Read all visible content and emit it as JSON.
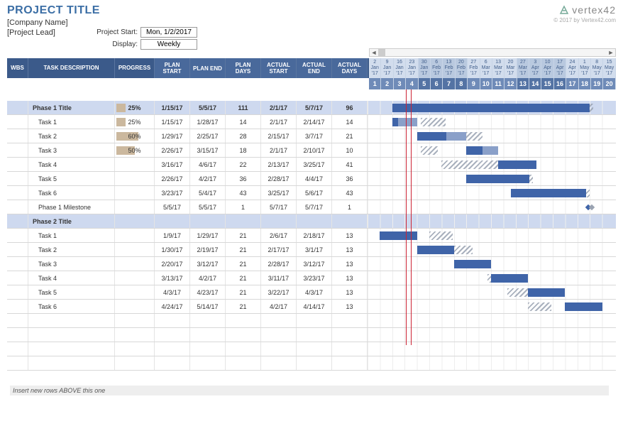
{
  "header": {
    "title": "PROJECT TITLE",
    "company": "[Company Name]",
    "lead": "[Project Lead]",
    "project_start_label": "Project Start:",
    "project_start_value": "Mon, 1/2/2017",
    "display_label": "Display:",
    "display_value": "Weekly",
    "logo_text": "vertex42",
    "copyright": "© 2017 by Vertex42.com"
  },
  "columns": {
    "wbs": "WBS",
    "task": "TASK DESCRIPTION",
    "progress": "PROGRESS",
    "plan_start": "PLAN START",
    "plan_end": "PLAN END",
    "plan_days": "PLAN DAYS",
    "actual_start": "ACTUAL START",
    "actual_end": "ACTUAL END",
    "actual_days": "ACTUAL DAYS"
  },
  "timeline": {
    "dates": [
      {
        "d": "2",
        "m": "Jan",
        "y": "'17"
      },
      {
        "d": "9",
        "m": "Jan",
        "y": "'17"
      },
      {
        "d": "16",
        "m": "Jan",
        "y": "'17"
      },
      {
        "d": "23",
        "m": "Jan",
        "y": "'17"
      },
      {
        "d": "30",
        "m": "Jan",
        "y": "'17"
      },
      {
        "d": "6",
        "m": "Feb",
        "y": "'17"
      },
      {
        "d": "13",
        "m": "Feb",
        "y": "'17"
      },
      {
        "d": "20",
        "m": "Feb",
        "y": "'17"
      },
      {
        "d": "27",
        "m": "Feb",
        "y": "'17"
      },
      {
        "d": "6",
        "m": "Mar",
        "y": "'17"
      },
      {
        "d": "13",
        "m": "Mar",
        "y": "'17"
      },
      {
        "d": "20",
        "m": "Mar",
        "y": "'17"
      },
      {
        "d": "27",
        "m": "Mar",
        "y": "'17"
      },
      {
        "d": "3",
        "m": "Apr",
        "y": "'17"
      },
      {
        "d": "10",
        "m": "Apr",
        "y": "'17"
      },
      {
        "d": "17",
        "m": "Apr",
        "y": "'17"
      },
      {
        "d": "24",
        "m": "Apr",
        "y": "'17"
      },
      {
        "d": "1",
        "m": "May",
        "y": "'17"
      },
      {
        "d": "8",
        "m": "May",
        "y": "'17"
      },
      {
        "d": "15",
        "m": "May",
        "y": "'17"
      }
    ],
    "weeks": [
      "1",
      "2",
      "3",
      "4",
      "5",
      "6",
      "7",
      "8",
      "9",
      "10",
      "11",
      "12",
      "13",
      "14",
      "15",
      "16",
      "17",
      "18",
      "19",
      "20"
    ],
    "today_lines": [
      3.0,
      3.4
    ]
  },
  "tasks": [
    {
      "type": "phase",
      "name": "Phase 1 Title",
      "progress": "25%",
      "prog_pct": 25,
      "ps": "1/15/17",
      "pe": "5/5/17",
      "pd": "111",
      "as": "2/1/17",
      "ae": "5/7/17",
      "ad": "96",
      "plan_s": 2,
      "plan_w": 16,
      "act_s": 4.3,
      "act_w": 14
    },
    {
      "type": "task",
      "name": "Task 1",
      "progress": "25%",
      "prog_pct": 25,
      "ps": "1/15/17",
      "pe": "1/28/17",
      "pd": "14",
      "as": "2/1/17",
      "ae": "2/14/17",
      "ad": "14",
      "plan_s": 2,
      "plan_w": 2,
      "act_s": 4.3,
      "act_w": 2,
      "plan_prog": 0.5
    },
    {
      "type": "task",
      "name": "Task 2",
      "progress": "60%",
      "prog_pct": 60,
      "ps": "1/29/17",
      "pe": "2/25/17",
      "pd": "28",
      "as": "2/15/17",
      "ae": "3/7/17",
      "ad": "21",
      "plan_s": 4,
      "plan_w": 4,
      "act_s": 6.3,
      "act_w": 3,
      "plan_prog": 2.4
    },
    {
      "type": "task",
      "name": "Task 3",
      "progress": "50%",
      "prog_pct": 50,
      "ps": "2/26/17",
      "pe": "3/15/17",
      "pd": "18",
      "as": "2/1/17",
      "ae": "2/10/17",
      "ad": "10",
      "plan_s": 8,
      "plan_w": 2.6,
      "act_s": 4.3,
      "act_w": 1.4,
      "plan_prog": 1.3
    },
    {
      "type": "task",
      "name": "Task 4",
      "progress": "",
      "prog_pct": 0,
      "ps": "3/16/17",
      "pe": "4/6/17",
      "pd": "22",
      "as": "2/13/17",
      "ae": "3/25/17",
      "ad": "41",
      "plan_s": 10.6,
      "plan_w": 3.1,
      "act_s": 6,
      "act_w": 5.9
    },
    {
      "type": "task",
      "name": "Task 5",
      "progress": "",
      "prog_pct": 0,
      "ps": "2/26/17",
      "pe": "4/2/17",
      "pd": "36",
      "as": "2/28/17",
      "ae": "4/4/17",
      "ad": "36",
      "plan_s": 8,
      "plan_w": 5.1,
      "act_s": 8.3,
      "act_w": 5.1
    },
    {
      "type": "task",
      "name": "Task 6",
      "progress": "",
      "prog_pct": 0,
      "ps": "3/23/17",
      "pe": "5/4/17",
      "pd": "43",
      "as": "3/25/17",
      "ae": "5/6/17",
      "ad": "43",
      "plan_s": 11.6,
      "plan_w": 6.1,
      "act_s": 11.9,
      "act_w": 6.1
    },
    {
      "type": "task",
      "name": "Phase 1 Milestone",
      "progress": "",
      "prog_pct": 0,
      "ps": "5/5/17",
      "pe": "5/5/17",
      "pd": "1",
      "as": "5/7/17",
      "ae": "5/7/17",
      "ad": "1",
      "milestone": true,
      "plan_s": 17.7,
      "act_s": 18
    },
    {
      "type": "phase",
      "name": "Phase 2 Title",
      "progress": "",
      "prog_pct": 0,
      "ps": "",
      "pe": "",
      "pd": "",
      "as": "",
      "ae": "",
      "ad": ""
    },
    {
      "type": "task",
      "name": "Task 1",
      "progress": "",
      "prog_pct": 0,
      "ps": "1/9/17",
      "pe": "1/29/17",
      "pd": "21",
      "as": "2/6/17",
      "ae": "2/18/17",
      "ad": "13",
      "plan_s": 1,
      "plan_w": 3,
      "act_s": 5,
      "act_w": 1.9
    },
    {
      "type": "task",
      "name": "Task 2",
      "progress": "",
      "prog_pct": 0,
      "ps": "1/30/17",
      "pe": "2/19/17",
      "pd": "21",
      "as": "2/17/17",
      "ae": "3/1/17",
      "ad": "13",
      "plan_s": 4,
      "plan_w": 3,
      "act_s": 6.6,
      "act_w": 1.9
    },
    {
      "type": "task",
      "name": "Task 3",
      "progress": "",
      "prog_pct": 0,
      "ps": "2/20/17",
      "pe": "3/12/17",
      "pd": "21",
      "as": "2/28/17",
      "ae": "3/12/17",
      "ad": "13",
      "plan_s": 7,
      "plan_w": 3,
      "act_s": 8.1,
      "act_w": 1.9
    },
    {
      "type": "task",
      "name": "Task 4",
      "progress": "",
      "prog_pct": 0,
      "ps": "3/13/17",
      "pe": "4/2/17",
      "pd": "21",
      "as": "3/11/17",
      "ae": "3/23/17",
      "ad": "13",
      "plan_s": 10,
      "plan_w": 3,
      "act_s": 9.7,
      "act_w": 1.9
    },
    {
      "type": "task",
      "name": "Task 5",
      "progress": "",
      "prog_pct": 0,
      "ps": "4/3/17",
      "pe": "4/23/17",
      "pd": "21",
      "as": "3/22/17",
      "ae": "4/3/17",
      "ad": "13",
      "plan_s": 13,
      "plan_w": 3,
      "act_s": 11.3,
      "act_w": 1.9
    },
    {
      "type": "task",
      "name": "Task 6",
      "progress": "",
      "prog_pct": 0,
      "ps": "4/24/17",
      "pe": "5/14/17",
      "pd": "21",
      "as": "4/2/17",
      "ae": "4/14/17",
      "ad": "13",
      "plan_s": 16,
      "plan_w": 3,
      "act_s": 13,
      "act_w": 1.9
    }
  ],
  "footer_note": "Insert new rows ABOVE this one"
}
